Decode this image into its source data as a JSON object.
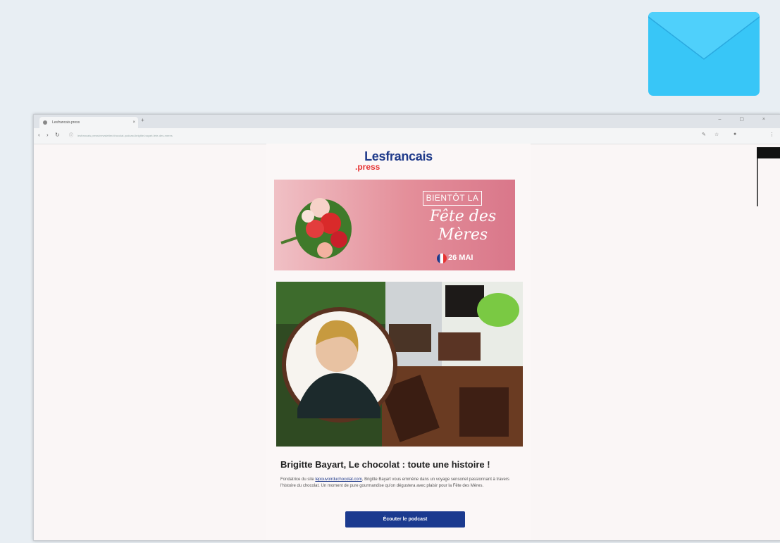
{
  "browser": {
    "tab_title": "Lesfrancais.press",
    "tab_close": "×",
    "new_tab": "+",
    "window_controls": "– ▢ ×",
    "url": "lesfrancais.press/newsletter/chocolat-podcast-brigitte-bayart-fete-des-meres",
    "nav": {
      "back": "‹",
      "forward": "›",
      "reload": "↻",
      "lock": "ⓘ"
    },
    "toolbar_icons": {
      "extensions": "✎",
      "star": "☆",
      "profile": "●",
      "menu": "⋮"
    }
  },
  "email": {
    "logo": {
      "top": "Lesfrancais",
      "bottom": ".press"
    },
    "banner": {
      "tag": "BIENTÔT LA",
      "title_line1": "Fête des",
      "title_line2": "Mères",
      "date": "26 MAI"
    },
    "headline": "Brigitte Bayart, Le chocolat : toute une histoire !",
    "body": {
      "intro": "Fondatrice du site",
      "link": "lepouvoirduchocolat.com",
      "rest": ", Brigitte Bayart vous emmène dans un voyage sensoriel passionnant à travers l'histoire du chocolat. Un moment de pure gourmandise qu'on dégustera avec plaisir pour la Fête des Mères."
    },
    "cta": "Écouter le podcast"
  },
  "colors": {
    "accent": "#1b3a8f",
    "logo_red": "#e63333",
    "mail_icon": "#38c6f7",
    "banner_pink": "#e48f9a"
  },
  "icons": {
    "mail": "envelope-icon",
    "flag": "french-flag-icon"
  }
}
